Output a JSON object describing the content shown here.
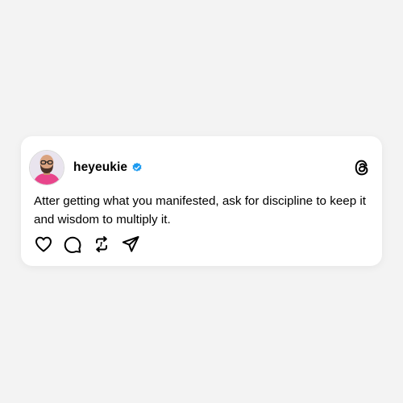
{
  "post": {
    "username": "heyeukie",
    "verified": true,
    "text": "Atter getting what you manifested, ask for discipline to keep it and wisdom to multiply it."
  },
  "icons": {
    "avatar": "profile-photo",
    "verified": "verified-badge-icon",
    "logo": "threads-logo-icon",
    "like": "heart-icon",
    "reply": "comment-bubble-icon",
    "repost": "repost-icon",
    "share": "send-icon"
  },
  "colors": {
    "background": "#f3f3f3",
    "card": "#ffffff",
    "text": "#000000",
    "verified": "#1d9bf0"
  }
}
